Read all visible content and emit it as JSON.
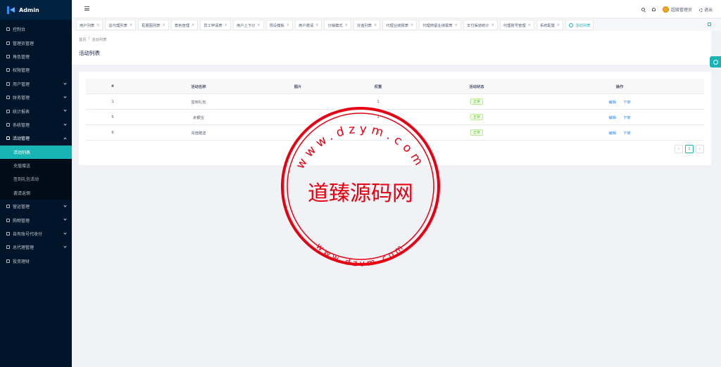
{
  "app": {
    "title": "Admin"
  },
  "sidebar": {
    "items": [
      {
        "label": "控制台",
        "icon": "dashboard-icon",
        "has_arrow": false
      },
      {
        "label": "管理员管理",
        "icon": "user-icon",
        "has_arrow": false
      },
      {
        "label": "角色管理",
        "icon": "team-icon",
        "has_arrow": false
      },
      {
        "label": "权限管理",
        "icon": "key-icon",
        "has_arrow": false
      },
      {
        "label": "用户管理",
        "icon": "user-icon",
        "has_arrow": true
      },
      {
        "label": "财务管理",
        "icon": "money-icon",
        "has_arrow": true
      },
      {
        "label": "统计报表",
        "icon": "chart-icon",
        "has_arrow": true
      },
      {
        "label": "系统管理",
        "icon": "gear-icon",
        "has_arrow": true
      },
      {
        "label": "活动管理",
        "icon": "gift-icon",
        "has_arrow": true,
        "open": true
      }
    ],
    "submenu": [
      {
        "label": "活动列表",
        "active": true
      },
      {
        "label": "充值赠送",
        "active": false
      },
      {
        "label": "签到礼包活动",
        "active": false
      },
      {
        "label": "邀请返佣",
        "active": false
      }
    ],
    "items_after": [
      {
        "label": "营运管理",
        "icon": "grid-icon",
        "has_arrow": true
      },
      {
        "label": "购物管理",
        "icon": "cart-icon",
        "has_arrow": true
      },
      {
        "label": "自有账号代收付",
        "icon": "card-icon",
        "has_arrow": true
      },
      {
        "label": "总代理管理",
        "icon": "grid-icon",
        "has_arrow": true
      },
      {
        "label": "投资理财",
        "icon": "grid-icon",
        "has_arrow": false
      }
    ]
  },
  "header": {
    "username": "超级管理员",
    "logout_label": "退出"
  },
  "tabs": [
    {
      "label": "用户列表",
      "active": false
    },
    {
      "label": "总代理列表",
      "active": false
    },
    {
      "label": "拓展图列表",
      "active": false
    },
    {
      "label": "角色管理",
      "active": false
    },
    {
      "label": "员工申请表",
      "active": false
    },
    {
      "label": "用户上下分",
      "active": false
    },
    {
      "label": "预设模板",
      "active": false
    },
    {
      "label": "用户邀请",
      "active": false
    },
    {
      "label": "分销模式",
      "active": false
    },
    {
      "label": "充值列表",
      "active": false
    },
    {
      "label": "代理业绩报表",
      "active": false
    },
    {
      "label": "代理商留业绩报表",
      "active": false
    },
    {
      "label": "支付渠道统计",
      "active": false
    },
    {
      "label": "代理账号管理",
      "active": false
    },
    {
      "label": "系统配置",
      "active": false
    },
    {
      "label": "活动列表",
      "active": true
    }
  ],
  "breadcrumb": {
    "home": "首页",
    "sep": "/",
    "current": "活动列表"
  },
  "page": {
    "title": "活动列表"
  },
  "table": {
    "columns": [
      "#",
      "活动名称",
      "图片",
      "权重",
      "活动状态",
      "操作"
    ],
    "rows": [
      {
        "id": "1",
        "name": "签到礼包",
        "image": "",
        "weight": "1",
        "status": "正常"
      },
      {
        "id": "5",
        "name": "余额宝",
        "image": "",
        "weight": "1",
        "status": "正常"
      },
      {
        "id": "6",
        "name": "充值赠送",
        "image": "",
        "weight": "1",
        "status": "正常"
      }
    ],
    "edit_label": "编辑",
    "offline_label": "下架"
  },
  "pagination": {
    "prev": "‹",
    "current": "1",
    "next": "›"
  },
  "watermark": {
    "center_text": "道臻源码网",
    "ring_text_top": "www.dzym.com",
    "ring_text_bottom": "www.dzym.com"
  }
}
